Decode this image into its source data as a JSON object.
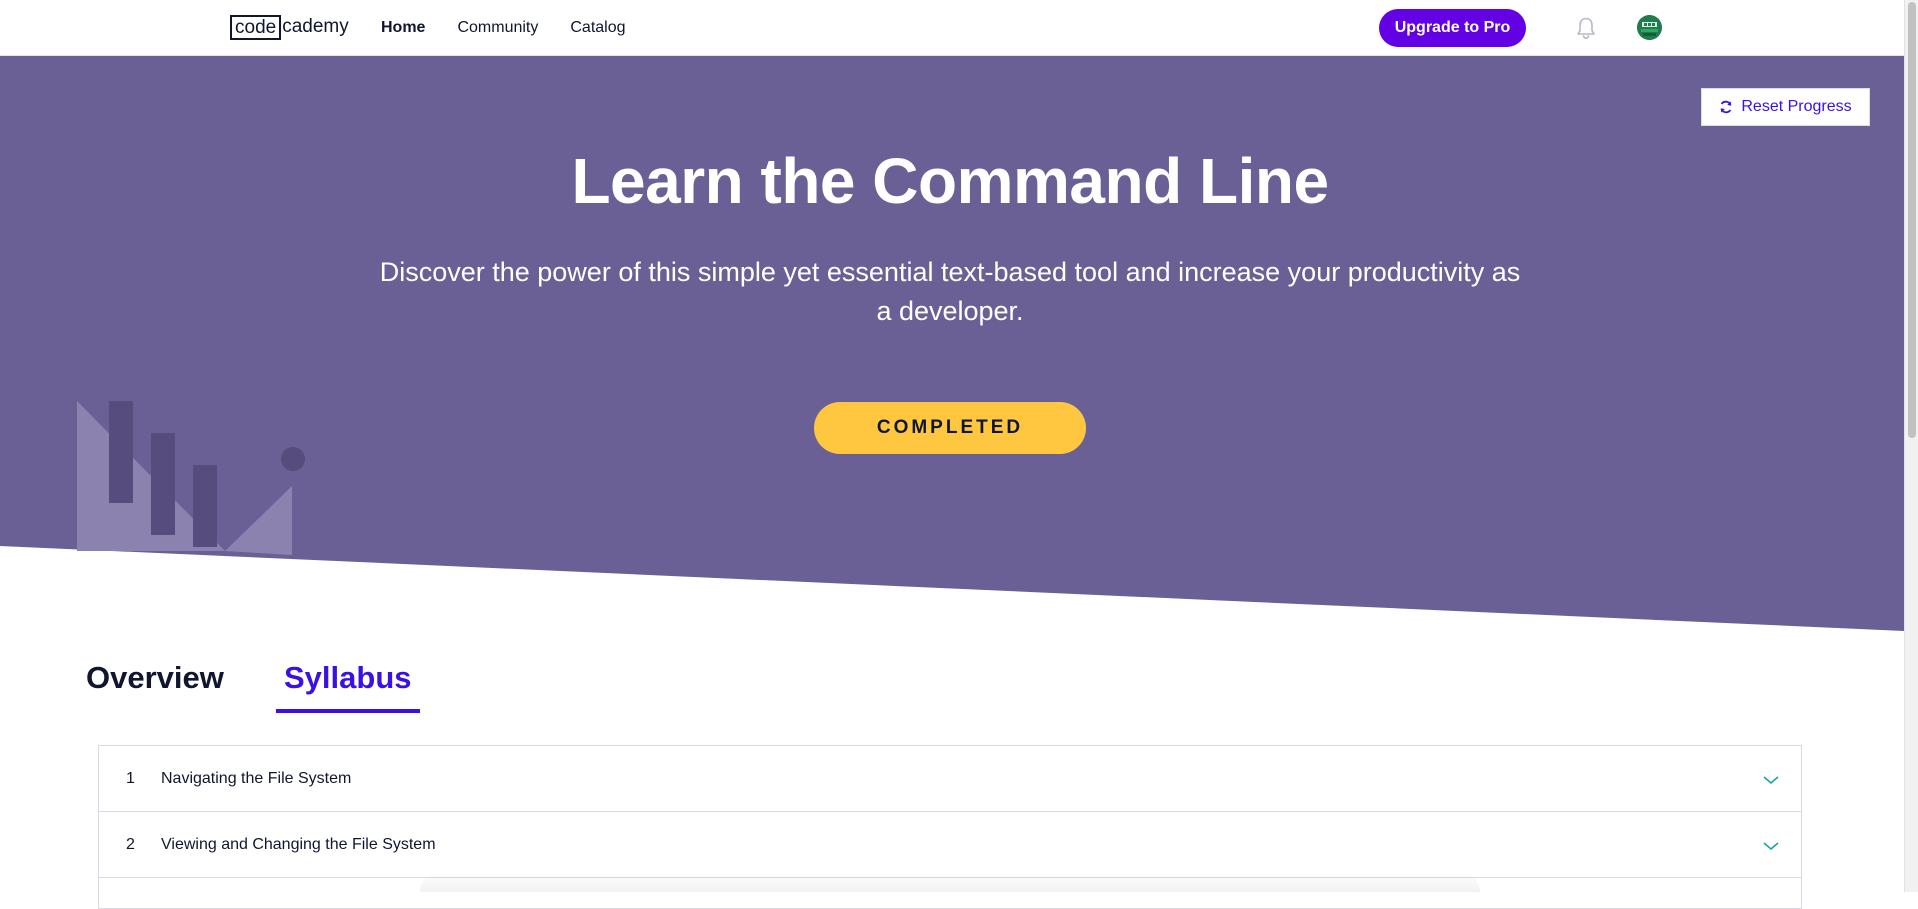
{
  "nav": {
    "logo_code": "code",
    "logo_cademy": "cademy",
    "links": [
      {
        "label": "Home",
        "active": true
      },
      {
        "label": "Community",
        "active": false
      },
      {
        "label": "Catalog",
        "active": false
      }
    ],
    "upgrade_label": "Upgrade to Pro",
    "bell_icon": "bell-icon",
    "avatar_icon": "user-avatar"
  },
  "hero": {
    "reset_label": "Reset Progress",
    "reset_icon": "refresh-icon",
    "title": "Learn the Command Line",
    "subtitle": "Discover the power of this simple yet essential text-based tool and increase your productivity as a developer.",
    "status_label": "COMPLETED"
  },
  "tabs": [
    {
      "label": "Overview",
      "active": false
    },
    {
      "label": "Syllabus",
      "active": true
    }
  ],
  "syllabus": {
    "modules": [
      {
        "number": "1",
        "title": "Navigating the File System"
      },
      {
        "number": "2",
        "title": "Viewing and Changing the File System"
      }
    ],
    "expand_icon": "chevron-down-icon"
  },
  "colors": {
    "hero_bg": "#6b6096",
    "brand_purple": "#6400e4",
    "accent_blue": "#3a10e5",
    "completed_yellow": "#ffc740",
    "chevron_teal": "#14a5a0",
    "text_dark": "#10162f"
  }
}
